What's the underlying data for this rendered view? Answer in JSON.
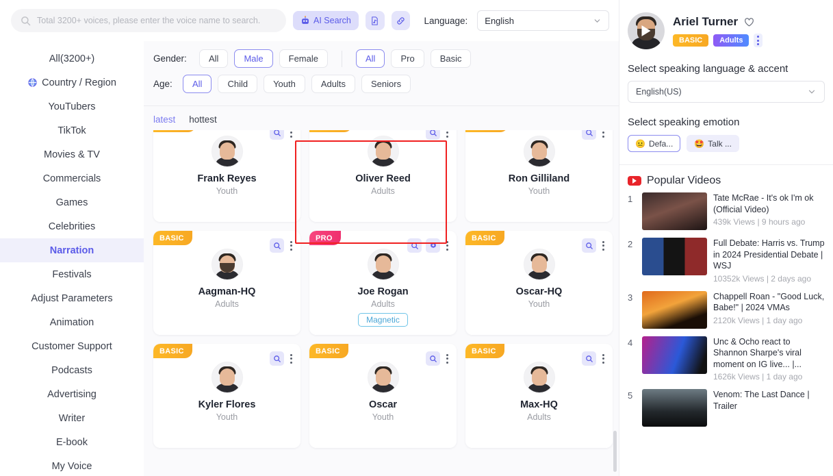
{
  "search": {
    "placeholder": "Total 3200+ voices, please enter the voice name to search.",
    "value": "",
    "ai_search_label": "AI Search",
    "language_label": "Language:",
    "language_value": "English"
  },
  "sidebar": {
    "items": [
      {
        "label": "All(3200+)",
        "icon": "",
        "active": false
      },
      {
        "label": "Country / Region",
        "icon": "globe-icon",
        "active": false
      },
      {
        "label": "YouTubers",
        "icon": "",
        "active": false
      },
      {
        "label": "TikTok",
        "icon": "",
        "active": false
      },
      {
        "label": "Movies & TV",
        "icon": "",
        "active": false
      },
      {
        "label": "Commercials",
        "icon": "",
        "active": false
      },
      {
        "label": "Games",
        "icon": "",
        "active": false
      },
      {
        "label": "Celebrities",
        "icon": "",
        "active": false
      },
      {
        "label": "Narration",
        "icon": "",
        "active": true
      },
      {
        "label": "Festivals",
        "icon": "",
        "active": false
      },
      {
        "label": "Adjust Parameters",
        "icon": "",
        "active": false
      },
      {
        "label": "Animation",
        "icon": "",
        "active": false
      },
      {
        "label": "Customer Support",
        "icon": "",
        "active": false
      },
      {
        "label": "Podcasts",
        "icon": "",
        "active": false
      },
      {
        "label": "Advertising",
        "icon": "",
        "active": false
      },
      {
        "label": "Writer",
        "icon": "",
        "active": false
      },
      {
        "label": "E-book",
        "icon": "",
        "active": false
      },
      {
        "label": "My Voice",
        "icon": "",
        "active": false
      }
    ]
  },
  "filters": {
    "gender_label": "Gender:",
    "gender_options": [
      "All",
      "Male",
      "Female"
    ],
    "gender_selected": "Male",
    "tier_options": [
      "All",
      "Pro",
      "Basic"
    ],
    "tier_selected": "All",
    "age_label": "Age:",
    "age_options": [
      "All",
      "Child",
      "Youth",
      "Adults",
      "Seniors"
    ],
    "age_selected": "All"
  },
  "sort": {
    "tabs": [
      "latest",
      "hottest"
    ],
    "active": "latest"
  },
  "voices": [
    {
      "name": "Frank Reyes",
      "age": "Youth",
      "ribbon": "",
      "tag": "",
      "gear": false,
      "selected": false,
      "clipped_top": true
    },
    {
      "name": "Oliver Reed",
      "age": "Adults",
      "ribbon": "",
      "tag": "",
      "gear": false,
      "selected": true,
      "clipped_top": true
    },
    {
      "name": "Ron Gilliland",
      "age": "Youth",
      "ribbon": "",
      "tag": "",
      "gear": false,
      "selected": false,
      "clipped_top": true
    },
    {
      "name": "Aagman-HQ",
      "age": "Adults",
      "ribbon": "BASIC",
      "tag": "",
      "gear": false,
      "selected": false,
      "clipped_top": false
    },
    {
      "name": "Joe Rogan",
      "age": "Adults",
      "ribbon": "PRO",
      "tag": "Magnetic",
      "gear": true,
      "selected": false,
      "clipped_top": false
    },
    {
      "name": "Oscar-HQ",
      "age": "Youth",
      "ribbon": "BASIC",
      "tag": "",
      "gear": false,
      "selected": false,
      "clipped_top": false
    },
    {
      "name": "Kyler Flores",
      "age": "Youth",
      "ribbon": "BASIC",
      "tag": "",
      "gear": false,
      "selected": false,
      "clipped_top": false
    },
    {
      "name": "Oscar",
      "age": "Youth",
      "ribbon": "BASIC",
      "tag": "",
      "gear": false,
      "selected": false,
      "clipped_top": false
    },
    {
      "name": "Max-HQ",
      "age": "Adults",
      "ribbon": "BASIC",
      "tag": "",
      "gear": false,
      "selected": false,
      "clipped_top": false
    }
  ],
  "detail": {
    "name": "Ariel Turner",
    "badges": [
      "BASIC",
      "Adults"
    ],
    "language_section_title": "Select speaking language & accent",
    "language_value": "English(US)",
    "emotion_section_title": "Select speaking emotion",
    "emotions": [
      {
        "emoji": "😐",
        "label": "Defa...",
        "selected": true
      },
      {
        "emoji": "🤩",
        "label": "Talk ...",
        "selected": false
      }
    ]
  },
  "popular": {
    "title": "Popular Videos",
    "videos": [
      {
        "rank": "1",
        "name": "Tate McRae - It's ok I'm ok (Official Video)",
        "sub": "439k Views | 9 hours ago"
      },
      {
        "rank": "2",
        "name": "Full Debate: Harris vs. Trump in 2024 Presidential Debate | WSJ",
        "sub": "10352k Views | 2 days ago"
      },
      {
        "rank": "3",
        "name": "Chappell Roan - \"Good Luck, Babe!\" | 2024 VMAs",
        "sub": "2120k Views | 1 day ago"
      },
      {
        "rank": "4",
        "name": "Unc & Ocho react to Shannon Sharpe's viral moment on IG live... |...",
        "sub": "1626k Views | 1 day ago"
      },
      {
        "rank": "5",
        "name": "Venom: The Last Dance | Trailer",
        "sub": ""
      }
    ]
  },
  "colors": {
    "accent": "#5b5be8",
    "basic": "#f7a823",
    "pro": "#ef2f6e",
    "selection": "#f01f1f",
    "youtube": "#e8242a"
  }
}
